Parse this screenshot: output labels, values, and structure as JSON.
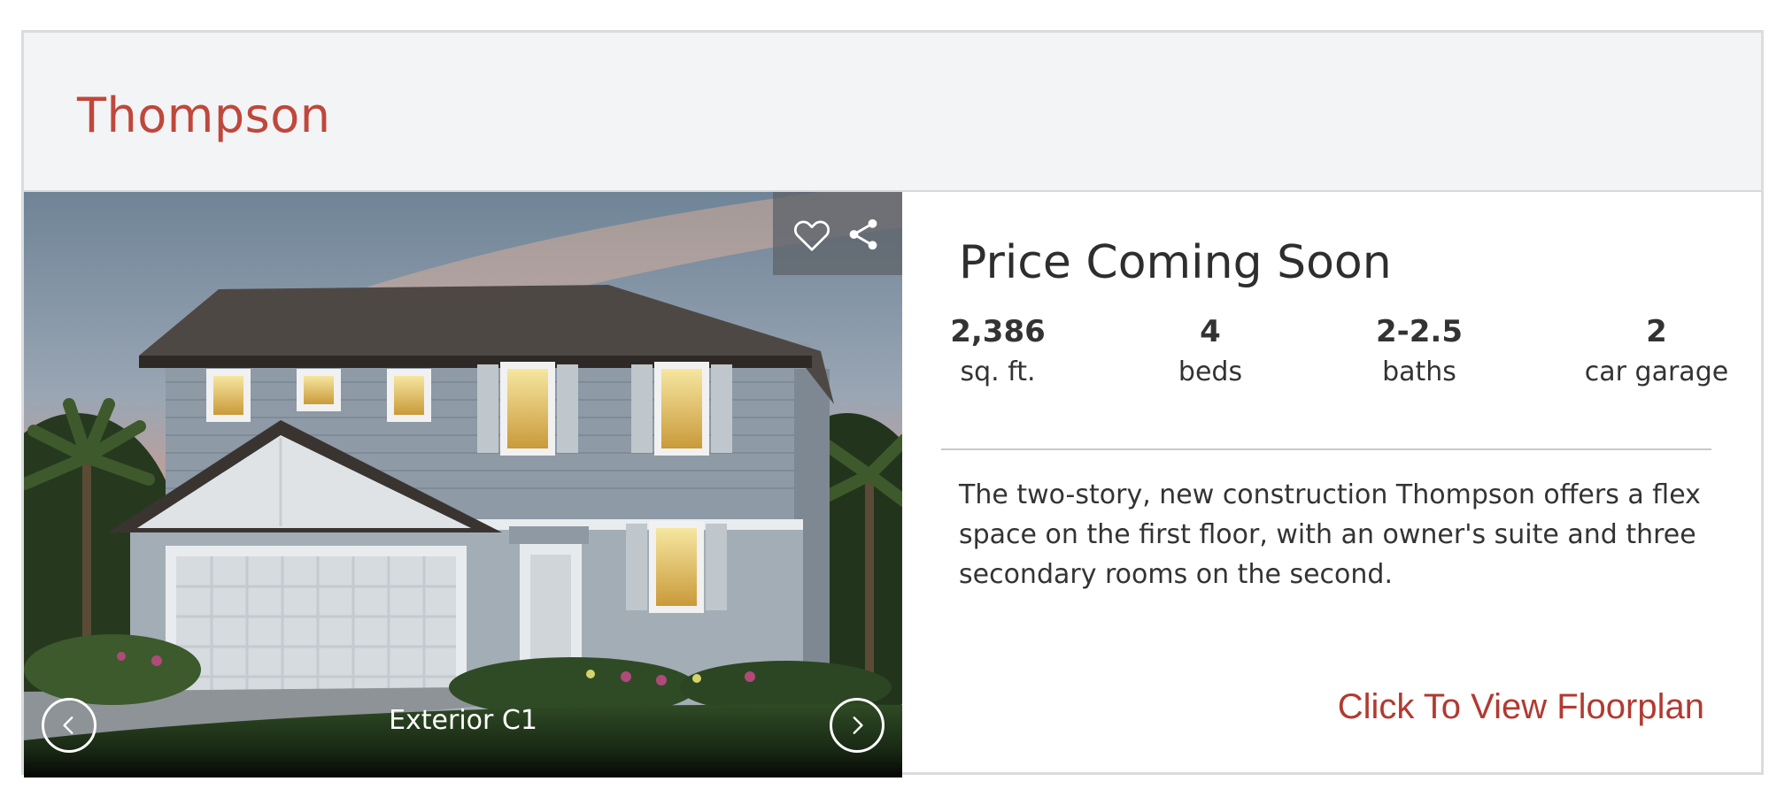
{
  "card": {
    "title": "Thompson",
    "media": {
      "caption": "Exterior C1",
      "actions": {
        "favorite_icon": "heart-outline-icon",
        "share_icon": "share-icon"
      },
      "nav": {
        "prev_icon": "chevron-left-icon",
        "next_icon": "chevron-right-icon"
      }
    },
    "price": "Price Coming Soon",
    "specs": [
      {
        "value": "2,386",
        "label": "sq. ft."
      },
      {
        "value": "4",
        "label": "beds"
      },
      {
        "value": "2-2.5",
        "label": "baths"
      },
      {
        "value": "2",
        "label": "car garage"
      }
    ],
    "description": "The two-story, new construction Thompson offers a flex space on the first floor, with an owner's suite and three secondary rooms on the second.",
    "floorplan_link": "Click To View Floorplan"
  },
  "colors": {
    "title": "#c0473b",
    "link": "#b23a30",
    "header_bg": "#f3f4f6"
  }
}
